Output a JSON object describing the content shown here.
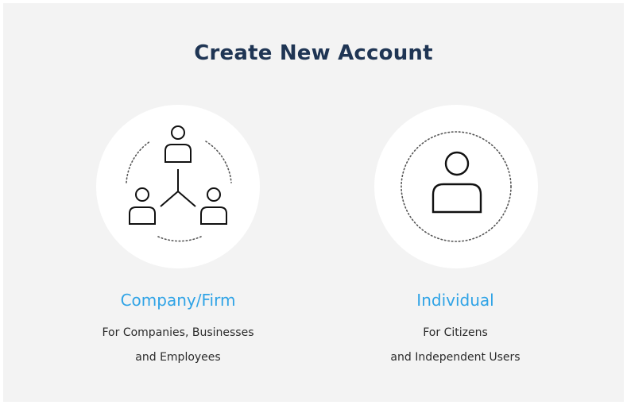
{
  "page": {
    "title": "Create New Account"
  },
  "options": [
    {
      "title": "Company/Firm",
      "description_line1": "For Companies, Businesses",
      "description_line2": "and Employees",
      "icon": "network-users-icon"
    },
    {
      "title": "Individual",
      "description_line1": "For Citizens",
      "description_line2": "and Independent Users",
      "icon": "user-icon"
    }
  ],
  "colors": {
    "background": "#f3f3f3",
    "title": "#1f3554",
    "accent": "#2fa3e6",
    "text": "#2b2b2b"
  }
}
